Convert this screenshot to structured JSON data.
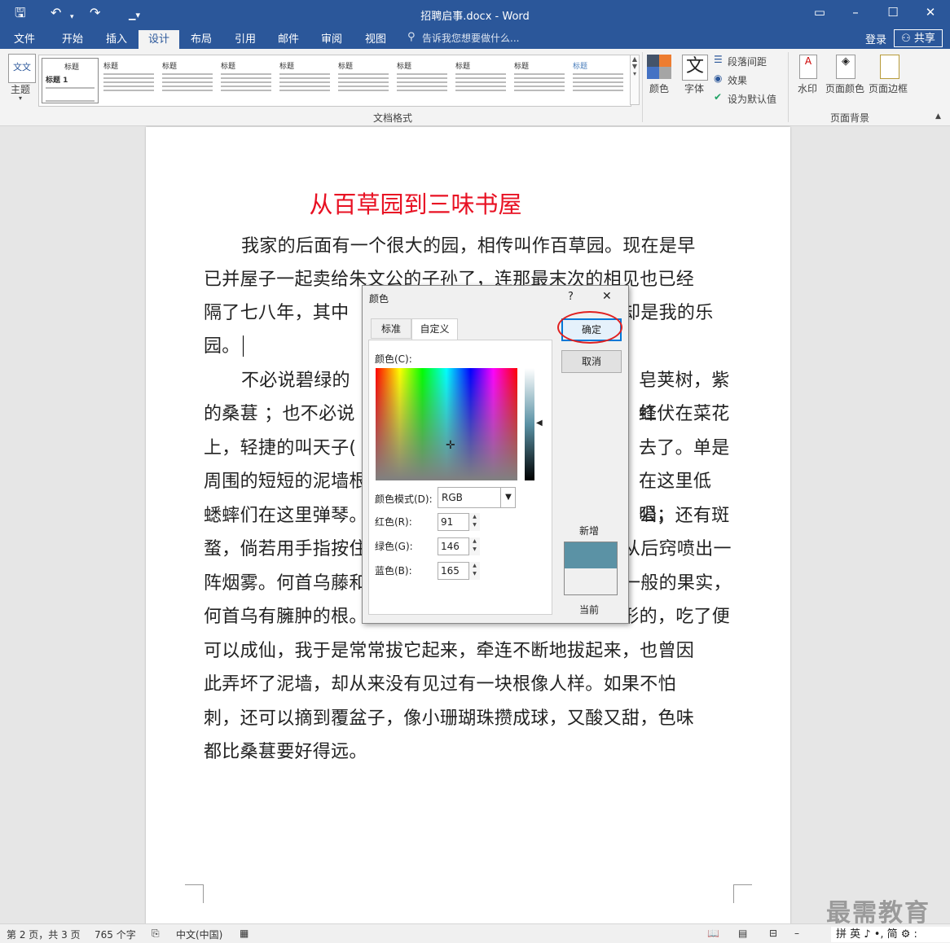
{
  "window": {
    "title": "招聘启事.docx - Word",
    "quick_access": [
      "save-icon",
      "undo-icon",
      "redo-icon",
      "customize-icon"
    ],
    "controls": [
      "?",
      "ribbon-display-icon",
      "minimize-icon",
      "maximize-icon",
      "close-icon"
    ]
  },
  "tabs": [
    "文件",
    "开始",
    "插入",
    "设计",
    "布局",
    "引用",
    "邮件",
    "审阅",
    "视图"
  ],
  "active_tab": "设计",
  "tell_me": "告诉我您想要做什么...",
  "account": {
    "login": "登录",
    "share": "共享"
  },
  "ribbon": {
    "theme_label": "主题",
    "gallery_heading": "标题",
    "gallery_first_label": "标题 1",
    "doc_format_label": "文档格式",
    "colors_label": "颜色",
    "fonts_label": "字体",
    "paragraph_spacing": "段落间距",
    "effects": "效果",
    "set_default": "设为默认值",
    "watermark": "水印",
    "page_color": "页面颜色",
    "page_borders": "页面边框",
    "page_background_label": "页面背景"
  },
  "document": {
    "heading": "从百草园到三味书屋",
    "para1_lines": [
      "我家的后面有一个很大的园，相传叫作百草园。现在是早",
      "已并屋子一起卖给朱文公的子孙了，连那最末次的相见也已经",
      "隔了七八年，其中",
      "园。"
    ],
    "para1_line3_tail": "却是我的乐",
    "para2_lines": [
      "不必说碧绿的",
      "的桑葚 ；也不必说",
      "上，轻捷的叫天子(",
      "周围的短短的泥墙根",
      "蟋蟀们在这里弹琴。",
      "蝥，倘若用手指按住",
      "阵烟雾。何首乌藤和",
      "何首乌有臃肿的根。",
      "可以成仙，我于是常常拔它起来，牵连不断地拔起来，也曾因",
      "此弄坏了泥墙，却从来没有见过有一块根像人样。如果不怕",
      "刺，还可以摘到覆盆子，像小珊瑚珠攒成球，又酸又甜，色味",
      "都比桑葚要好得远。"
    ],
    "para2_tails": [
      "皂荚树，紫红",
      "蜂伏在菜花",
      "去了。单是",
      "在这里低唱，",
      "公；还有斑",
      "从后窍喷出一",
      "一般的果实，",
      "人形的，吃了便"
    ]
  },
  "dialog": {
    "title": "颜色",
    "help": "?",
    "close": "✕",
    "tabs": [
      "标准",
      "自定义"
    ],
    "active_tab": "自定义",
    "colors_label": "颜色(C):",
    "color_model_label": "颜色模式(D):",
    "color_model_value": "RGB",
    "red_label": "红色(R):",
    "red_value": "91",
    "green_label": "绿色(G):",
    "green_value": "146",
    "blue_label": "蓝色(B):",
    "blue_value": "165",
    "ok": "确定",
    "cancel": "取消",
    "new_label": "新增",
    "current_label": "当前",
    "new_color": "#5b92a5",
    "current_color": "#f0f0f0"
  },
  "statusbar": {
    "page": "第 2 页，共 3 页",
    "words": "765 个字",
    "language": "中文(中国)"
  },
  "watermark_text": "最需教育",
  "ime": "拼 英 ♪ •, 简 ⚙ :"
}
